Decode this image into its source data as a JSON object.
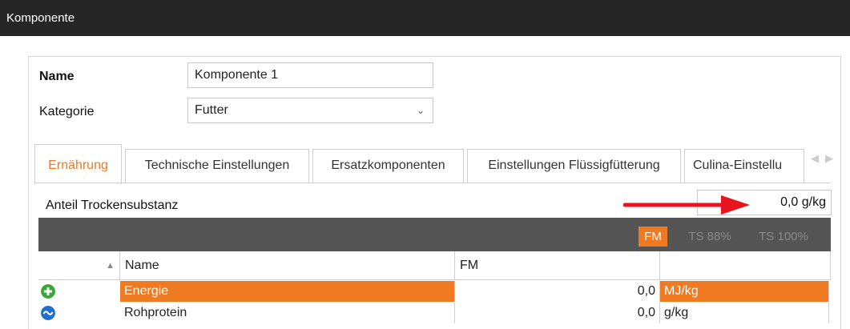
{
  "window": {
    "title": "Komponente"
  },
  "form": {
    "name_label": "Name",
    "name_value": "Komponente 1",
    "category_label": "Kategorie",
    "category_value": "Futter"
  },
  "tabs": [
    {
      "label": "Ernährung",
      "active": true
    },
    {
      "label": "Technische Einstellungen",
      "active": false
    },
    {
      "label": "Ersatzkomponenten",
      "active": false
    },
    {
      "label": "Einstellungen Flüssigfütterung",
      "active": false
    },
    {
      "label": "Culina-Einstellu",
      "active": false
    }
  ],
  "tab_scroll": {
    "left_icon": "chevron-left-icon",
    "right_icon": "chevron-right-icon"
  },
  "dry_matter": {
    "label": "Anteil Trockensubstanz",
    "value": "0,0 g/kg"
  },
  "annotation": {
    "arrow_color": "#e8141e"
  },
  "mode_buttons": [
    {
      "label": "FM",
      "active": true
    },
    {
      "label": "TS 88%",
      "active": false
    },
    {
      "label": "TS 100%",
      "active": false
    }
  ],
  "table": {
    "sort_icon": "sort-ascending-icon",
    "columns": {
      "name": "Name",
      "fm": "FM",
      "unit": ""
    },
    "rows": [
      {
        "icon": "plus-circle-icon",
        "icon_color": "#3aa63a",
        "name": "Energie",
        "fm": "0,0",
        "unit": "MJ/kg",
        "selected": true
      },
      {
        "icon": "wave-circle-icon",
        "icon_color": "#1f6fd1",
        "name": "Rohprotein",
        "fm": "0,0",
        "unit": "g/kg",
        "selected": false
      }
    ]
  },
  "colors": {
    "accent": "#f07a22",
    "titlebar": "#262626",
    "toolbar": "#555555"
  }
}
